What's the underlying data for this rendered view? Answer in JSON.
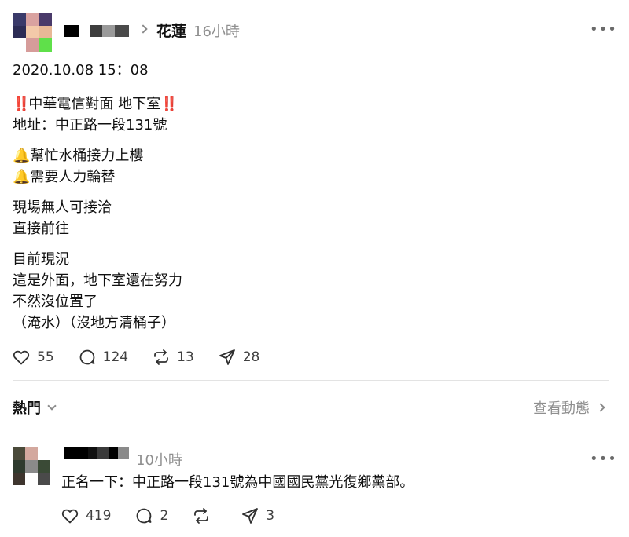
{
  "post": {
    "topic": "花蓮",
    "time": "16小時",
    "more": "•••",
    "lines": [
      "2020.10.08 15：08",
      "中華電信對面 地下室",
      "地址：中正路一段131號",
      "幫忙水桶接力上樓",
      "需要人力輪替",
      "現場無人可接洽",
      "直接前往",
      "目前現況",
      "這是外面，地下室還在努力",
      "不然沒位置了",
      "（淹水）（沒地方清桶子）"
    ],
    "emoji": {
      "bang": "‼️",
      "bell": "🔔"
    },
    "likes": "55",
    "comments": "124",
    "reposts": "13",
    "shares": "28"
  },
  "section": {
    "hot_label": "熱門",
    "activity_label": "查看動態"
  },
  "reply": {
    "time": "10小時",
    "more": "•••",
    "text": "正名一下：中正路一段131號為中國國民黨光復鄉黨部。",
    "likes": "419",
    "comments": "2",
    "shares": "3"
  },
  "colors": {
    "muted": "#8f8f8f",
    "text": "#101010",
    "divider": "#e3e3e3"
  }
}
